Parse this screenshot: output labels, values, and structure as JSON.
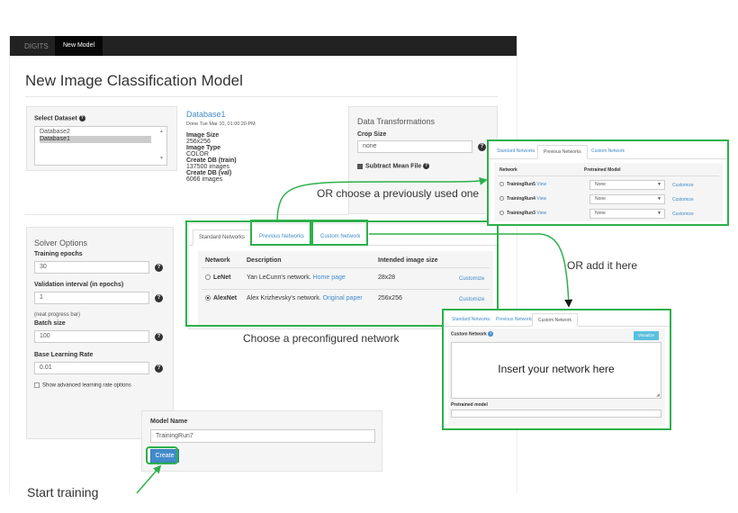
{
  "navbar": {
    "brand": "DIGITS",
    "active_item": "New Model"
  },
  "page": {
    "title": "New Image Classification Model"
  },
  "dataset": {
    "label": "Select Dataset",
    "options": [
      "Database2",
      "Database1"
    ],
    "selected": "Database1",
    "info": {
      "name": "Database1",
      "done": "Done Tue Mar 10, 01:00:20 PM",
      "image_size_label": "Image Size",
      "image_size": "256x256",
      "image_type_label": "Image Type",
      "image_type": "COLOR",
      "train_label": "Create DB (train)",
      "train": "137500 images",
      "val_label": "Create DB (val)",
      "val": "6066 images"
    }
  },
  "transforms": {
    "title": "Data Transformations",
    "crop_label": "Crop Size",
    "crop_value": "none",
    "mean_label": "Subtract Mean File"
  },
  "solver": {
    "title": "Solver Options",
    "epochs_label": "Training epochs",
    "epochs": "30",
    "val_interval_label": "Validation interval (in epochs)",
    "val_interval": "1",
    "note": "(neat progress bar)",
    "batch_label": "Batch size",
    "batch": "100",
    "lr_label": "Base Learning Rate",
    "lr": "0.01",
    "adv_label": "Show advanced learning rate options"
  },
  "networks": {
    "tabs": [
      "Standard Networks",
      "Previous Networks",
      "Custom Network"
    ],
    "headers": [
      "Network",
      "Description",
      "Intended image size"
    ],
    "rows": [
      {
        "name": "LeNet",
        "desc": "Yan LeCunn's network.",
        "link": "Home page",
        "size": "28x28",
        "action": "Customize"
      },
      {
        "name": "AlexNet",
        "desc": "Alex Krizhevsky's network.",
        "link": "Original paper",
        "size": "256x256",
        "action": "Customize"
      }
    ]
  },
  "model": {
    "name_label": "Model Name",
    "name_value": "TrainingRun7",
    "create_label": "Create"
  },
  "previous_panel": {
    "tabs": [
      "Standard Networks",
      "Previous Networks",
      "Custom Network"
    ],
    "headers": [
      "Network",
      "Pretrained Model"
    ],
    "rows": [
      {
        "name": "TrainingRun5",
        "view": "View",
        "model": "None",
        "action": "Customize"
      },
      {
        "name": "TrainingRun4",
        "view": "View",
        "model": "None",
        "action": "Customize"
      },
      {
        "name": "TrainingRun3",
        "view": "View",
        "model": "None",
        "action": "Customize"
      }
    ]
  },
  "custom_panel": {
    "tabs": [
      "Standard Networks",
      "Previous Networks",
      "Custom Network"
    ],
    "label": "Custom Network",
    "visualize": "Visualize",
    "placeholder": "Insert your network here",
    "pretrained_label": "Pretrained model"
  },
  "annotations": {
    "previous": "OR choose a previously used one",
    "add_here": "OR add it here",
    "preconfigured": "Choose a preconfigured network",
    "start": "Start training"
  },
  "colors": {
    "highlight": "#2db04b",
    "link": "#428bca",
    "navbar": "#222222",
    "create_button": "#428bca"
  }
}
